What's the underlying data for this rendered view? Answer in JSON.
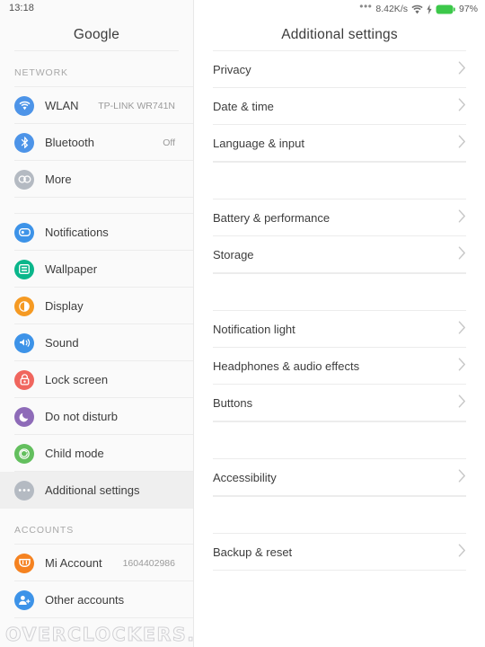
{
  "statusbar": {
    "time": "13:18",
    "overflow_dots": "•••",
    "network_speed": "8.42K/s",
    "wifi_icon": "wifi-icon",
    "charging_icon": "charging-bolt-icon",
    "battery_icon": "battery-icon",
    "battery_percent": "97%",
    "battery_color": "#3cc84a"
  },
  "sidebar": {
    "title": "Google",
    "sections": [
      {
        "label": "NETWORK",
        "items": [
          {
            "label": "WLAN",
            "value": "TP-LINK WR741N",
            "icon": "wlan-icon",
            "color": "#4d94e8",
            "selected": false
          },
          {
            "label": "Bluetooth",
            "value": "Off",
            "icon": "bluetooth-icon",
            "color": "#4d94e8",
            "selected": false
          },
          {
            "label": "More",
            "value": "",
            "icon": "more-icon",
            "color": "#b4bac2",
            "selected": false
          }
        ]
      },
      {
        "label": "",
        "items": [
          {
            "label": "Notifications",
            "value": "",
            "icon": "notifications-icon",
            "color": "#3d93e8",
            "selected": false
          },
          {
            "label": "Wallpaper",
            "value": "",
            "icon": "wallpaper-icon",
            "color": "#0ab68b",
            "selected": false
          },
          {
            "label": "Display",
            "value": "",
            "icon": "display-icon",
            "color": "#f59a23",
            "selected": false
          },
          {
            "label": "Sound",
            "value": "",
            "icon": "sound-icon",
            "color": "#3d93e8",
            "selected": false
          },
          {
            "label": "Lock screen",
            "value": "",
            "icon": "lock-screen-icon",
            "color": "#f0665e",
            "selected": false
          },
          {
            "label": "Do not disturb",
            "value": "",
            "icon": "do-not-disturb-icon",
            "color": "#8e6bb8",
            "selected": false
          },
          {
            "label": "Child mode",
            "value": "",
            "icon": "child-mode-icon",
            "color": "#63bf5e",
            "selected": false
          },
          {
            "label": "Additional settings",
            "value": "",
            "icon": "additional-settings-icon",
            "color": "#b4bac2",
            "selected": true
          }
        ]
      },
      {
        "label": "ACCOUNTS",
        "items": [
          {
            "label": "Mi Account",
            "value": "1604402986",
            "icon": "mi-account-icon",
            "color": "#f58220",
            "selected": false
          },
          {
            "label": "Other accounts",
            "value": "",
            "icon": "other-accounts-icon",
            "color": "#3d93e8",
            "selected": false
          }
        ]
      }
    ]
  },
  "main": {
    "title": "Additional settings",
    "chevron_icon": "chevron-right-icon",
    "groups": [
      {
        "items": [
          {
            "label": "Privacy"
          },
          {
            "label": "Date & time"
          },
          {
            "label": "Language & input"
          }
        ]
      },
      {
        "items": [
          {
            "label": "Battery & performance"
          },
          {
            "label": "Storage"
          }
        ]
      },
      {
        "items": [
          {
            "label": "Notification light"
          },
          {
            "label": "Headphones & audio effects"
          },
          {
            "label": "Buttons"
          }
        ]
      },
      {
        "items": [
          {
            "label": "Accessibility"
          }
        ]
      },
      {
        "items": [
          {
            "label": "Backup & reset"
          }
        ]
      }
    ]
  },
  "watermark": {
    "text": "OVERCLOCKERS.UA"
  }
}
